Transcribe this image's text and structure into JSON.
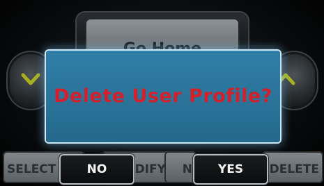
{
  "background": {
    "top_button_label": "Go Home",
    "bottom_keys": {
      "select": "SELECT",
      "modify": "MODIFY",
      "name": "N",
      "delete": "DELETE"
    },
    "left_arrow_icon": "chevron-down-icon",
    "right_arrow_icon": "chevron-up-icon"
  },
  "dialog": {
    "message": "Delete User Profile?",
    "no_label": "NO",
    "yes_label": "YES"
  },
  "colors": {
    "modal_bg": "#2a7399",
    "message_text": "#d3202a",
    "arrow_accent": "#a8b020"
  }
}
